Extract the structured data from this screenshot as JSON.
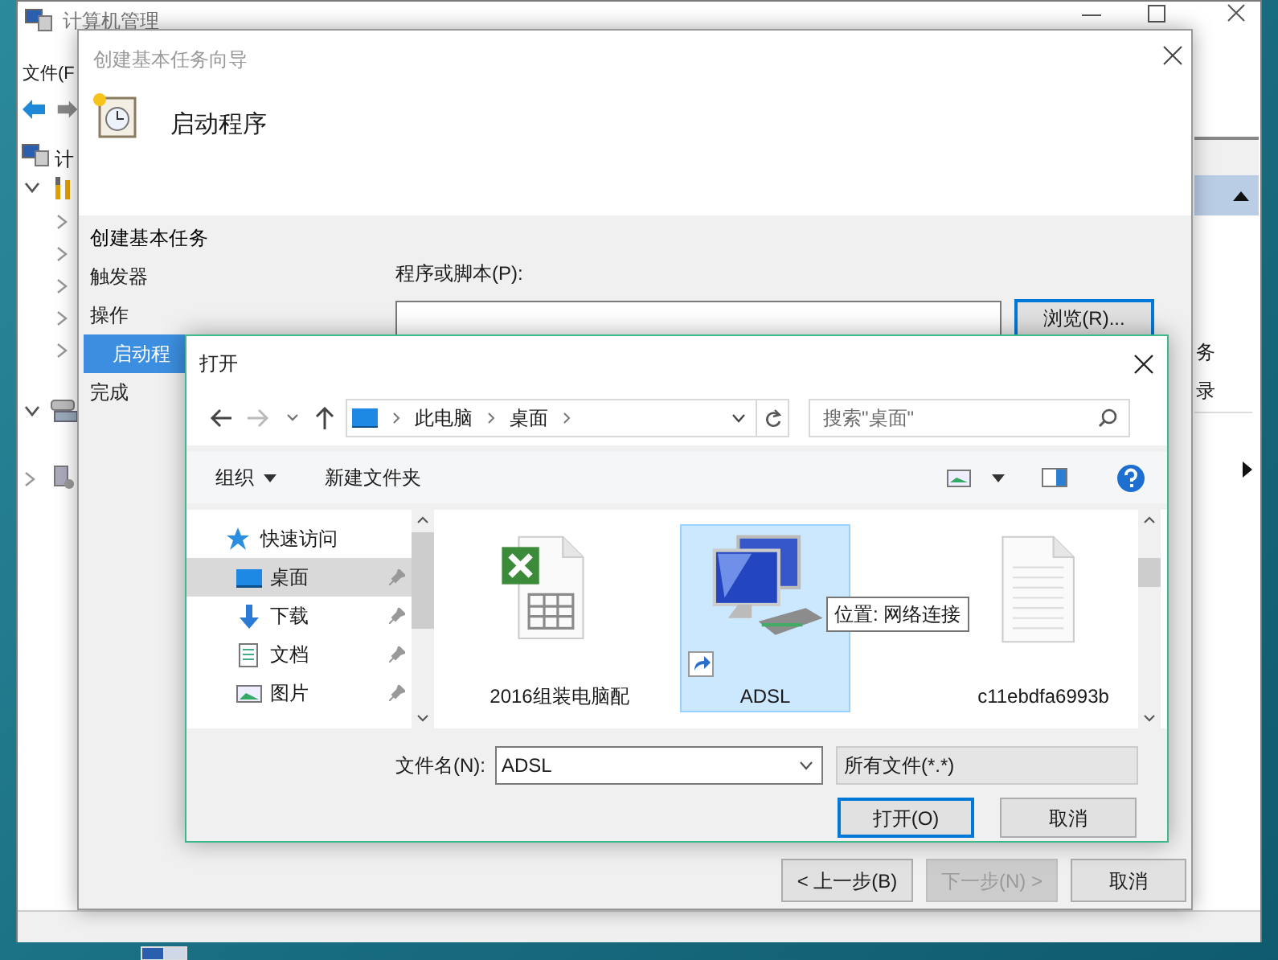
{
  "back_window": {
    "title": "计算机管理",
    "menu": [
      "文件(F"
    ],
    "tree_label": "计",
    "side_texts": [
      "务",
      "录"
    ]
  },
  "wizard": {
    "title": "创建基本任务向导",
    "heading": "启动程序",
    "steps": [
      {
        "label": "创建基本任务",
        "kind": "title",
        "selected": false
      },
      {
        "label": "触发器",
        "kind": "step",
        "selected": false
      },
      {
        "label": "操作",
        "kind": "step",
        "selected": false,
        "children": [
          {
            "label": "启动程",
            "kind": "step",
            "selected": true
          }
        ]
      },
      {
        "label": "完成",
        "kind": "step",
        "selected": false
      }
    ],
    "field_label": "程序或脚本(P):",
    "browse": "浏览(R)...",
    "buttons": [
      {
        "label": "< 上一步(B)",
        "disabled": false
      },
      {
        "label": "下一步(N) >",
        "disabled": true
      },
      {
        "label": "取消",
        "disabled": false
      }
    ]
  },
  "open_dialog": {
    "title": "打开",
    "path": [
      "此电脑",
      "桌面"
    ],
    "search": {
      "placeholder": "搜索\"桌面\""
    },
    "toolbar": [
      {
        "label": "组织",
        "dropdown": true
      },
      {
        "label": "新建文件夹",
        "dropdown": false
      }
    ],
    "nav": [
      {
        "label": "快速访问",
        "kind": "star",
        "selected": false,
        "pinned": false
      },
      {
        "label": "桌面",
        "kind": "desktop",
        "selected": true,
        "pinned": true
      },
      {
        "label": "下载",
        "kind": "download",
        "selected": false,
        "pinned": true
      },
      {
        "label": "文档",
        "kind": "document",
        "selected": false,
        "pinned": true
      },
      {
        "label": "图片",
        "kind": "picture",
        "selected": false,
        "pinned": true
      }
    ],
    "files": [
      {
        "name": "2016组装电脑配",
        "kind": "excel",
        "selected": false,
        "shortcut": false
      },
      {
        "name": "ADSL",
        "kind": "network",
        "selected": true,
        "shortcut": true
      },
      {
        "name": "c11ebdfa6993b",
        "kind": "text",
        "selected": false,
        "shortcut": false
      }
    ],
    "tooltip": "位置: 网络连接",
    "filename_label": "文件名(N):",
    "filename": "ADSL",
    "filter": "所有文件(*.*)",
    "buttons": [
      {
        "label": "打开(O)",
        "default": true
      },
      {
        "label": "取消",
        "default": false
      }
    ]
  }
}
